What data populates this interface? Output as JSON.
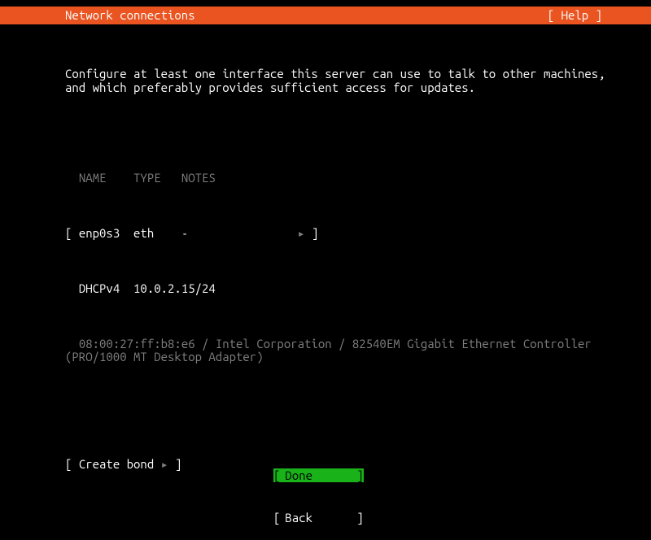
{
  "header": {
    "title": "Network connections",
    "help_label": "[ Help ]"
  },
  "description": "Configure at least one interface this server can use to talk to other machines,\nand which preferably provides sufficient access for updates.",
  "columns": {
    "name": "NAME",
    "type": "TYPE",
    "notes": "NOTES"
  },
  "interface": {
    "name": "enp0s3",
    "type": "eth",
    "notes": "-",
    "bracket_open": "[",
    "bracket_close": "]",
    "dhcp_label": "DHCPv4",
    "dhcp_value": "10.0.2.15/24",
    "hw_info": "08:00:27:ff:b8:e6 / Intel Corporation / 82540EM Gigabit Ethernet Controller\n(PRO/1000 MT Desktop Adapter)"
  },
  "create_bond": {
    "bracket_open": "[",
    "label": "Create bond",
    "bracket_close": "]"
  },
  "arrow_glyph": "▸",
  "buttons": {
    "done": "Done",
    "back": "Back",
    "bracket_open": "[",
    "bracket_close": "]"
  }
}
